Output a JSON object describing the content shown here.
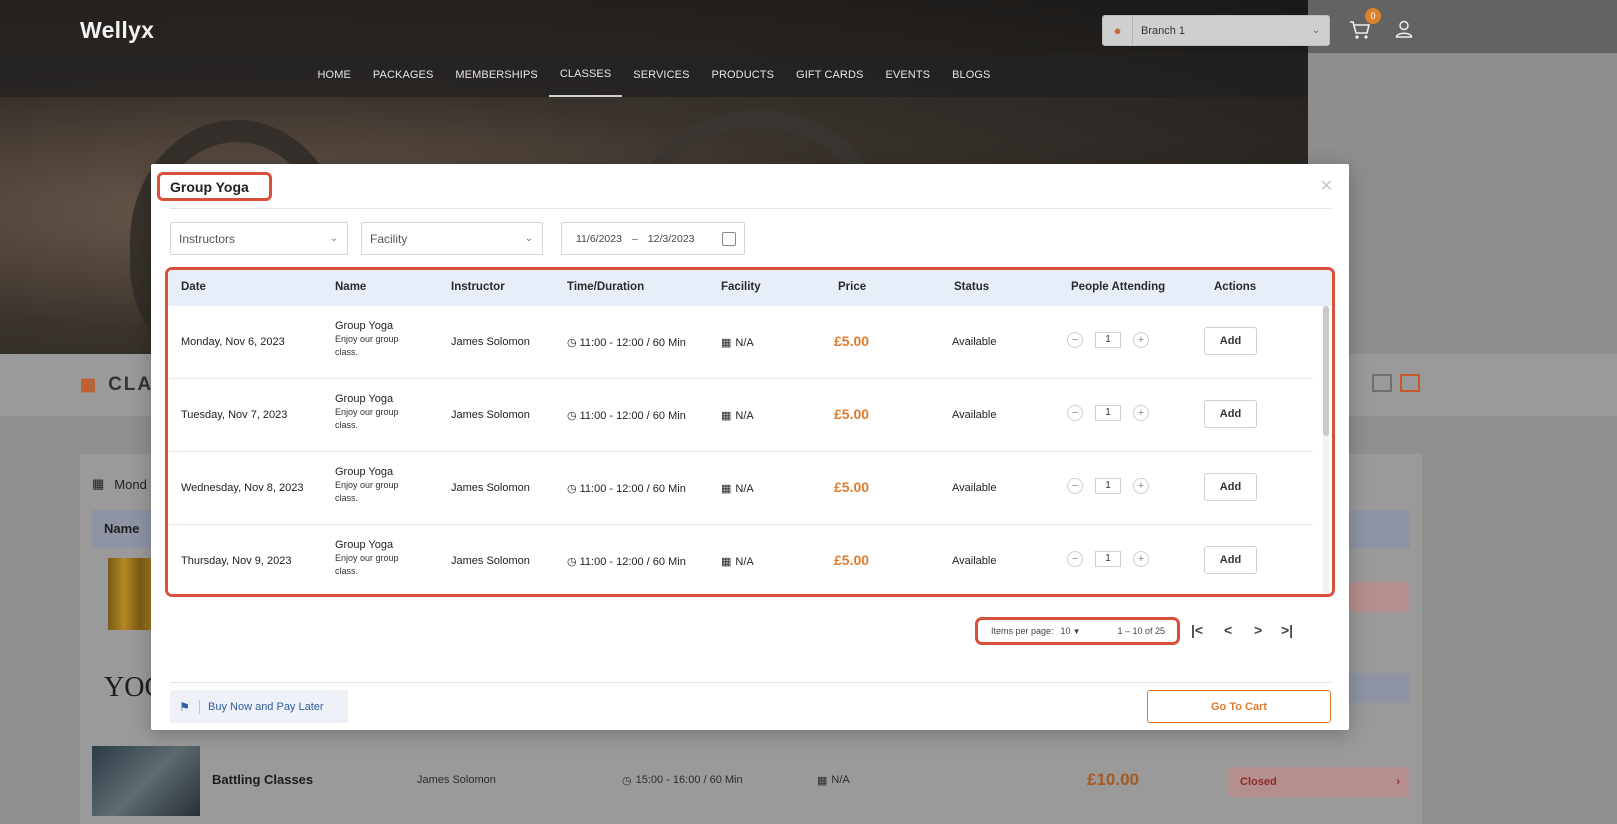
{
  "header": {
    "logo": "Wellyx",
    "branch": "Branch 1",
    "cart_count": "0"
  },
  "nav": [
    "HOME",
    "PACKAGES",
    "MEMBERSHIPS",
    "CLASSES",
    "SERVICES",
    "PRODUCTS",
    "GIFT CARDS",
    "EVENTS",
    "BLOGS"
  ],
  "page": {
    "section_title": "CLA",
    "list_date": "Mond",
    "list_name_header": "Name",
    "yoga_logo": "YOG",
    "bg_row": {
      "name": "Battling Classes",
      "instructor": "James Solomon",
      "time": "15:00 - 16:00 / 60 Min",
      "facility": "N/A",
      "price": "£10.00",
      "status": "Closed"
    }
  },
  "modal": {
    "title": "Group Yoga",
    "filters": {
      "instructors": "Instructors",
      "facility": "Facility",
      "date_from": "11/6/2023",
      "date_sep": "–",
      "date_to": "12/3/2023"
    },
    "columns": [
      "Date",
      "Name",
      "Instructor",
      "Time/Duration",
      "Facility",
      "Price",
      "Status",
      "People Attending",
      "Actions"
    ],
    "rows": [
      {
        "date": "Monday, Nov 6, 2023",
        "name": "Group Yoga",
        "desc": "Enjoy our group class.",
        "instructor": "James Solomon",
        "time": "11:00 - 12:00 / 60 Min",
        "facility": "N/A",
        "price": "£5.00",
        "status": "Available",
        "qty": "1",
        "action": "Add"
      },
      {
        "date": "Tuesday, Nov 7, 2023",
        "name": "Group Yoga",
        "desc": "Enjoy our group class.",
        "instructor": "James Solomon",
        "time": "11:00 - 12:00 / 60 Min",
        "facility": "N/A",
        "price": "£5.00",
        "status": "Available",
        "qty": "1",
        "action": "Add"
      },
      {
        "date": "Wednesday, Nov 8, 2023",
        "name": "Group Yoga",
        "desc": "Enjoy our group class.",
        "instructor": "James Solomon",
        "time": "11:00 - 12:00 / 60 Min",
        "facility": "N/A",
        "price": "£5.00",
        "status": "Available",
        "qty": "1",
        "action": "Add"
      },
      {
        "date": "Thursday, Nov 9, 2023",
        "name": "Group Yoga",
        "desc": "Enjoy our group class.",
        "instructor": "James Solomon",
        "time": "11:00 - 12:00 / 60 Min",
        "facility": "N/A",
        "price": "£5.00",
        "status": "Available",
        "qty": "1",
        "action": "Add"
      }
    ],
    "pagination": {
      "items_per_page_label": "Items per page:",
      "items_per_page": "10",
      "range": "1 – 10 of 25"
    },
    "footer": {
      "bnpl": "Buy Now and Pay Later",
      "go_to_cart": "Go To Cart"
    }
  },
  "colors": {
    "accent": "#e07b2e",
    "highlight": "#d9503a",
    "table_header": "#e8eef8"
  }
}
